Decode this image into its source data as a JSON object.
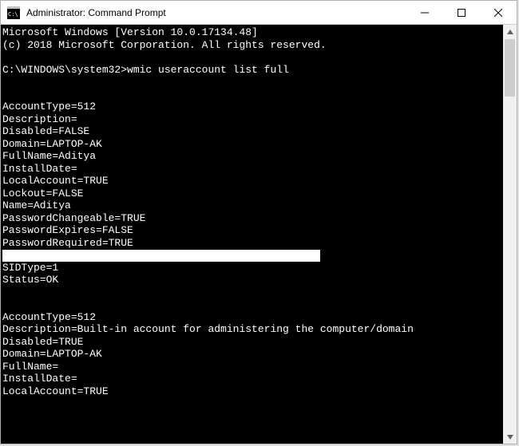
{
  "window": {
    "title": "Administrator: Command Prompt",
    "icon_name": "cmd-icon"
  },
  "terminal": {
    "header": [
      "Microsoft Windows [Version 10.0.17134.48]",
      "(c) 2018 Microsoft Corporation. All rights reserved.",
      ""
    ],
    "prompt": "C:\\WINDOWS\\system32>",
    "command": "wmic useraccount list full",
    "accounts": [
      {
        "AccountType": "512",
        "Description": "",
        "Disabled": "FALSE",
        "Domain": "LAPTOP-AK",
        "FullName": "Aditya",
        "InstallDate": "",
        "LocalAccount": "TRUE",
        "Lockout": "FALSE",
        "Name": "Aditya",
        "PasswordChangeable": "TRUE",
        "PasswordExpires": "FALSE",
        "PasswordRequired": "TRUE",
        "SID_redacted": true,
        "SIDType": "1",
        "Status": "OK"
      },
      {
        "AccountType": "512",
        "Description": "Built-in account for administering the computer/domain",
        "Disabled": "TRUE",
        "Domain": "LAPTOP-AK",
        "FullName": "",
        "InstallDate": "",
        "LocalAccount": "TRUE"
      }
    ]
  },
  "labels": {
    "AccountType": "AccountType",
    "Description": "Description",
    "Disabled": "Disabled",
    "Domain": "Domain",
    "FullName": "FullName",
    "InstallDate": "InstallDate",
    "LocalAccount": "LocalAccount",
    "Lockout": "Lockout",
    "Name": "Name",
    "PasswordChangeable": "PasswordChangeable",
    "PasswordExpires": "PasswordExpires",
    "PasswordRequired": "PasswordRequired",
    "SIDType": "SIDType",
    "Status": "Status"
  }
}
